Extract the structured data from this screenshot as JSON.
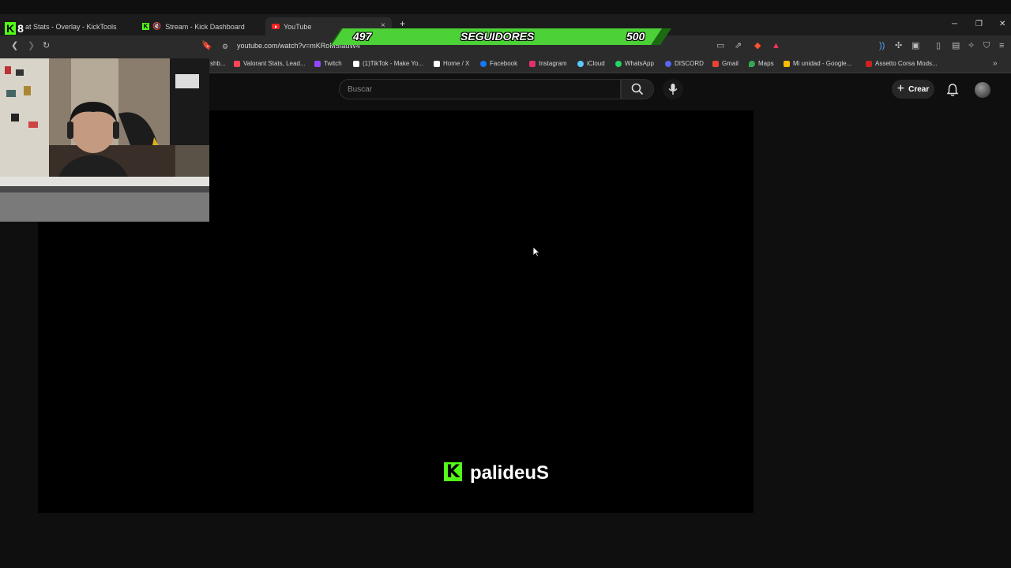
{
  "browser": {
    "tabs": [
      {
        "title": "at Stats - Overlay - KickTools"
      },
      {
        "title": "Stream - Kick Dashboard"
      },
      {
        "title": "YouTube"
      }
    ],
    "url": "youtube.com/watch?v=mKRoM5IadW4",
    "bookmarks": [
      {
        "label": "shb...",
        "color": "#888888"
      },
      {
        "label": "Valorant Stats, Lead...",
        "color": "#ff4655"
      },
      {
        "label": "Twitch",
        "color": "#9146ff"
      },
      {
        "label": "(1)TikTok - Make Yo...",
        "color": "#ffffff"
      },
      {
        "label": "Home / X",
        "color": "#ffffff"
      },
      {
        "label": "Facebook",
        "color": "#1877f2"
      },
      {
        "label": "Instagram",
        "color": "#e1306c"
      },
      {
        "label": "iCloud",
        "color": "#5ac8fa"
      },
      {
        "label": "WhatsApp",
        "color": "#25d366"
      },
      {
        "label": "DISCORD",
        "color": "#5865f2"
      },
      {
        "label": "Gmail",
        "color": "#ea4335"
      },
      {
        "label": "Maps",
        "color": "#34a853"
      },
      {
        "label": "Mi unidad - Google...",
        "color": "#fbbc04"
      },
      {
        "label": "Assetto Corsa Mods...",
        "color": "#cc2222"
      }
    ]
  },
  "youtube": {
    "search_placeholder": "Buscar",
    "create_label": "Crear"
  },
  "player": {
    "channel_name": "palideuS"
  },
  "overlay": {
    "badge_k": "K",
    "badge_number": "8",
    "followers_current": "497",
    "followers_label": "SEGUIDORES",
    "followers_goal": "500",
    "accent_color": "#53fc18"
  }
}
